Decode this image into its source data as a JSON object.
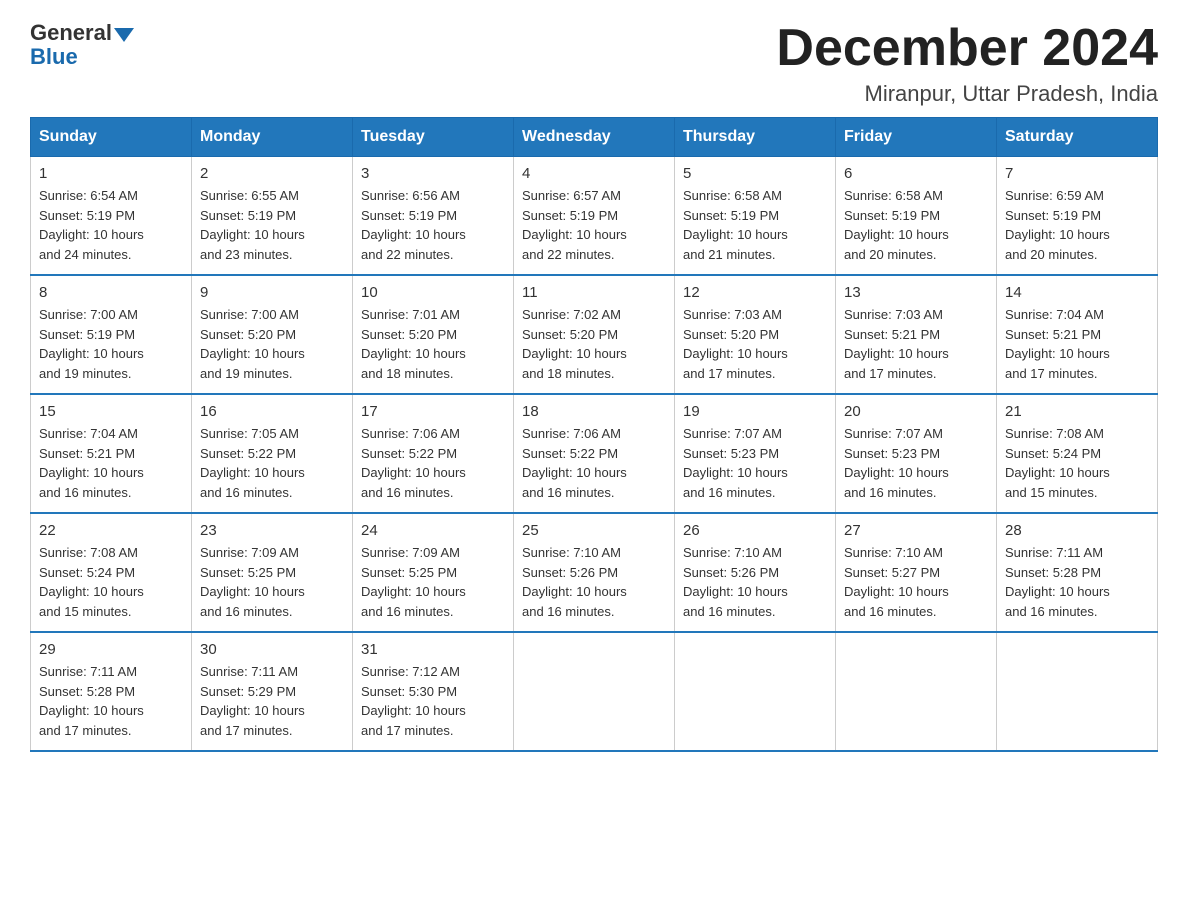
{
  "logo": {
    "general": "General",
    "blue": "Blue"
  },
  "title": "December 2024",
  "location": "Miranpur, Uttar Pradesh, India",
  "days_of_week": [
    "Sunday",
    "Monday",
    "Tuesday",
    "Wednesday",
    "Thursday",
    "Friday",
    "Saturday"
  ],
  "weeks": [
    [
      {
        "day": "1",
        "sunrise": "6:54 AM",
        "sunset": "5:19 PM",
        "daylight": "10 hours and 24 minutes."
      },
      {
        "day": "2",
        "sunrise": "6:55 AM",
        "sunset": "5:19 PM",
        "daylight": "10 hours and 23 minutes."
      },
      {
        "day": "3",
        "sunrise": "6:56 AM",
        "sunset": "5:19 PM",
        "daylight": "10 hours and 22 minutes."
      },
      {
        "day": "4",
        "sunrise": "6:57 AM",
        "sunset": "5:19 PM",
        "daylight": "10 hours and 22 minutes."
      },
      {
        "day": "5",
        "sunrise": "6:58 AM",
        "sunset": "5:19 PM",
        "daylight": "10 hours and 21 minutes."
      },
      {
        "day": "6",
        "sunrise": "6:58 AM",
        "sunset": "5:19 PM",
        "daylight": "10 hours and 20 minutes."
      },
      {
        "day": "7",
        "sunrise": "6:59 AM",
        "sunset": "5:19 PM",
        "daylight": "10 hours and 20 minutes."
      }
    ],
    [
      {
        "day": "8",
        "sunrise": "7:00 AM",
        "sunset": "5:19 PM",
        "daylight": "10 hours and 19 minutes."
      },
      {
        "day": "9",
        "sunrise": "7:00 AM",
        "sunset": "5:20 PM",
        "daylight": "10 hours and 19 minutes."
      },
      {
        "day": "10",
        "sunrise": "7:01 AM",
        "sunset": "5:20 PM",
        "daylight": "10 hours and 18 minutes."
      },
      {
        "day": "11",
        "sunrise": "7:02 AM",
        "sunset": "5:20 PM",
        "daylight": "10 hours and 18 minutes."
      },
      {
        "day": "12",
        "sunrise": "7:03 AM",
        "sunset": "5:20 PM",
        "daylight": "10 hours and 17 minutes."
      },
      {
        "day": "13",
        "sunrise": "7:03 AM",
        "sunset": "5:21 PM",
        "daylight": "10 hours and 17 minutes."
      },
      {
        "day": "14",
        "sunrise": "7:04 AM",
        "sunset": "5:21 PM",
        "daylight": "10 hours and 17 minutes."
      }
    ],
    [
      {
        "day": "15",
        "sunrise": "7:04 AM",
        "sunset": "5:21 PM",
        "daylight": "10 hours and 16 minutes."
      },
      {
        "day": "16",
        "sunrise": "7:05 AM",
        "sunset": "5:22 PM",
        "daylight": "10 hours and 16 minutes."
      },
      {
        "day": "17",
        "sunrise": "7:06 AM",
        "sunset": "5:22 PM",
        "daylight": "10 hours and 16 minutes."
      },
      {
        "day": "18",
        "sunrise": "7:06 AM",
        "sunset": "5:22 PM",
        "daylight": "10 hours and 16 minutes."
      },
      {
        "day": "19",
        "sunrise": "7:07 AM",
        "sunset": "5:23 PM",
        "daylight": "10 hours and 16 minutes."
      },
      {
        "day": "20",
        "sunrise": "7:07 AM",
        "sunset": "5:23 PM",
        "daylight": "10 hours and 16 minutes."
      },
      {
        "day": "21",
        "sunrise": "7:08 AM",
        "sunset": "5:24 PM",
        "daylight": "10 hours and 15 minutes."
      }
    ],
    [
      {
        "day": "22",
        "sunrise": "7:08 AM",
        "sunset": "5:24 PM",
        "daylight": "10 hours and 15 minutes."
      },
      {
        "day": "23",
        "sunrise": "7:09 AM",
        "sunset": "5:25 PM",
        "daylight": "10 hours and 16 minutes."
      },
      {
        "day": "24",
        "sunrise": "7:09 AM",
        "sunset": "5:25 PM",
        "daylight": "10 hours and 16 minutes."
      },
      {
        "day": "25",
        "sunrise": "7:10 AM",
        "sunset": "5:26 PM",
        "daylight": "10 hours and 16 minutes."
      },
      {
        "day": "26",
        "sunrise": "7:10 AM",
        "sunset": "5:26 PM",
        "daylight": "10 hours and 16 minutes."
      },
      {
        "day": "27",
        "sunrise": "7:10 AM",
        "sunset": "5:27 PM",
        "daylight": "10 hours and 16 minutes."
      },
      {
        "day": "28",
        "sunrise": "7:11 AM",
        "sunset": "5:28 PM",
        "daylight": "10 hours and 16 minutes."
      }
    ],
    [
      {
        "day": "29",
        "sunrise": "7:11 AM",
        "sunset": "5:28 PM",
        "daylight": "10 hours and 17 minutes."
      },
      {
        "day": "30",
        "sunrise": "7:11 AM",
        "sunset": "5:29 PM",
        "daylight": "10 hours and 17 minutes."
      },
      {
        "day": "31",
        "sunrise": "7:12 AM",
        "sunset": "5:30 PM",
        "daylight": "10 hours and 17 minutes."
      },
      null,
      null,
      null,
      null
    ]
  ]
}
